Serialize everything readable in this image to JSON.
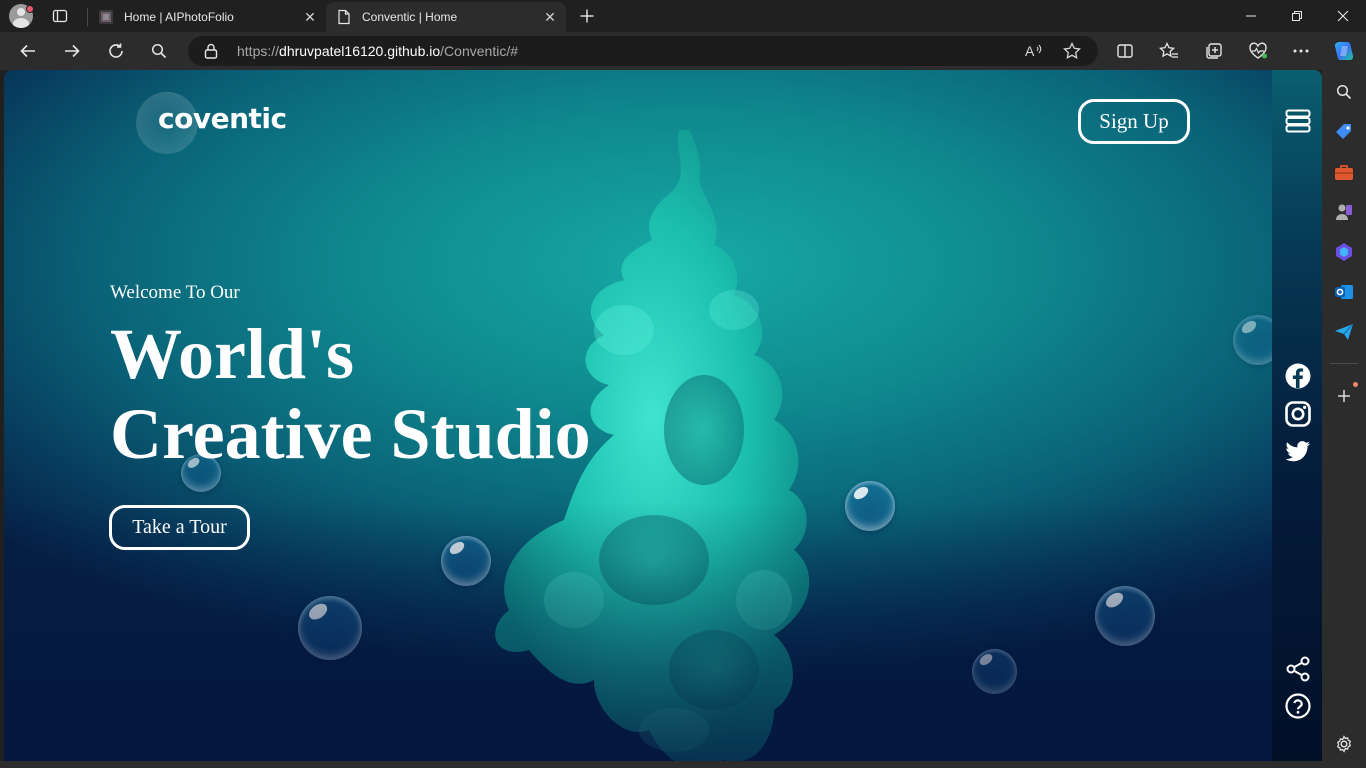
{
  "browser": {
    "tabs": [
      {
        "title": "Home | AIPhotoFolio",
        "active": false
      },
      {
        "title": "Conventic | Home",
        "active": true
      }
    ],
    "url_prefix": "https://",
    "url_host": "dhruvpatel16120.github.io",
    "url_path": "/Conventic/#"
  },
  "page": {
    "logo": "coventic",
    "signup_label": "Sign Up",
    "welcome": "Welcome To Our",
    "headline_line1": "World's",
    "headline_line2": "Creative Studio",
    "tour_label": "Take a Tour"
  },
  "colors": {
    "accent": "#14b0aa",
    "deep": "#061f45",
    "text": "#ffffff"
  },
  "icons": {
    "rail": [
      "menu-icon",
      "facebook-icon",
      "instagram-icon",
      "twitter-icon",
      "share-icon",
      "help-icon"
    ],
    "edge_sidebar": [
      "search-icon",
      "shopping-tag-icon",
      "tools-icon",
      "games-icon",
      "copilot-icon",
      "outlook-icon",
      "send-icon",
      "add-icon",
      "settings-icon"
    ]
  }
}
